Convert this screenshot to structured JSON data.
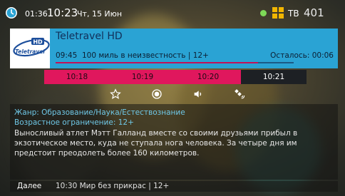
{
  "topbar": {
    "time_small": "01:36",
    "time_big": "10:23",
    "date": "Чт, 15 Июн",
    "tv_label": "ТВ",
    "channel_number": "401"
  },
  "program": {
    "channel_name": "Teletravel HD",
    "logo_text": "Teletravel",
    "logo_badge": "HD",
    "start_time": "09:45",
    "title_line": "100 миль в неизвестность | 12+",
    "remaining": "Осталось: 00:06",
    "progress": 0.85
  },
  "timeline": [
    "10:18",
    "10:19",
    "10:20",
    "10:21"
  ],
  "actions": [
    "star-icon",
    "record-icon",
    "volume-icon",
    "satellite-icon"
  ],
  "details": {
    "genre": "Жанр: Образование/Наука/Естествознание",
    "age": "Возрастное ограничение: 12+",
    "description": "Выносливый атлет Мэтт Галланд вместе со своими друзьями прибыл в экзотическое место, куда не ступала нога человека. За четыре дня им предстоит преодолеть более 160 километров."
  },
  "next": {
    "label": "Далее",
    "program": "10:30  Мир без прикрас | 12+"
  },
  "colors": {
    "accent": "#2aa3d4",
    "timeline": "#e0175d",
    "highlight_text": "#6fc7e6"
  }
}
